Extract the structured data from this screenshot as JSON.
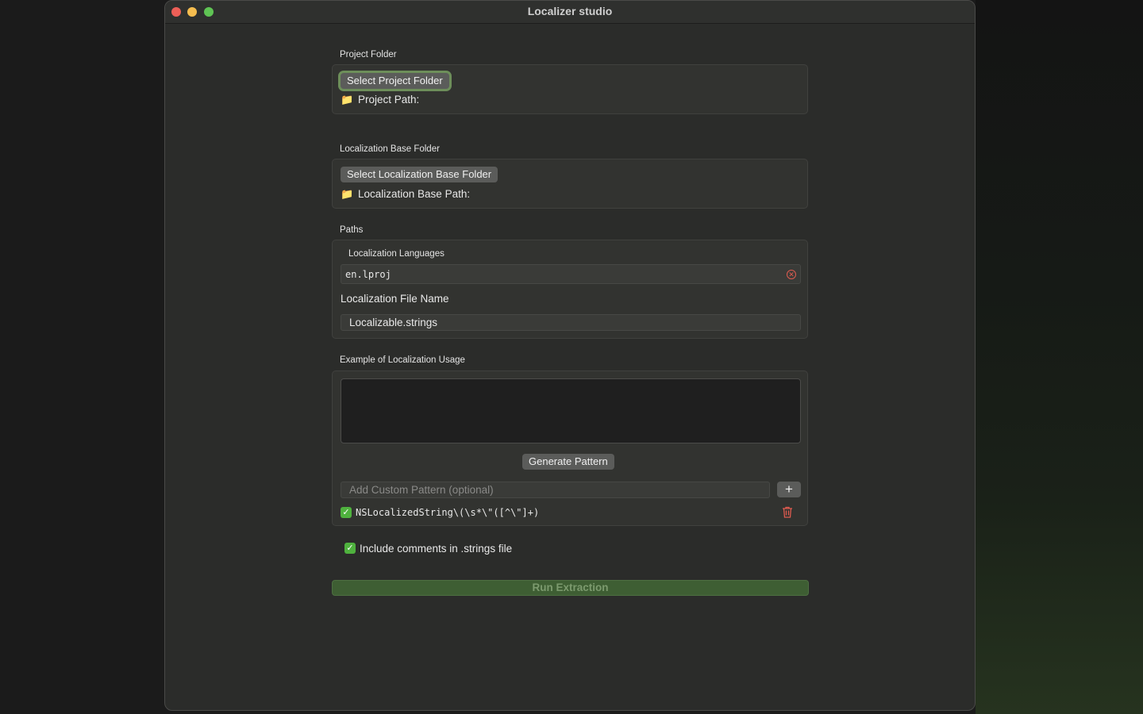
{
  "window": {
    "title": "Localizer studio"
  },
  "project_folder": {
    "section_label": "Project Folder",
    "button_label": "Select Project Folder",
    "path_icon": "📁",
    "path_label": "Project Path:"
  },
  "localization_base": {
    "section_label": "Localization Base Folder",
    "button_label": "Select Localization Base Folder",
    "path_icon": "📁",
    "path_label": "Localization Base Path:"
  },
  "paths": {
    "section_label": "Paths",
    "languages_label": "Localization Languages",
    "languages_value": "en.lproj",
    "file_name_label": "Localization File Name",
    "file_name_value": "Localizable.strings"
  },
  "example": {
    "section_label": "Example of Localization Usage",
    "textarea_value": "",
    "generate_button": "Generate Pattern",
    "custom_pattern_placeholder": "Add Custom Pattern (optional)",
    "add_button": "+",
    "patterns": [
      {
        "checked": true,
        "text": "NSLocalizedString\\(\\s*\\\"([^\\\"]+)"
      }
    ]
  },
  "options": {
    "include_comments_checked": true,
    "include_comments_label": "Include comments in .strings file"
  },
  "run_button": "Run Extraction",
  "colors": {
    "window_bg": "#2b2c2a",
    "accent_green": "#4fb23e",
    "run_bar": "#3e5e33",
    "clear_red": "#e05b4f"
  }
}
